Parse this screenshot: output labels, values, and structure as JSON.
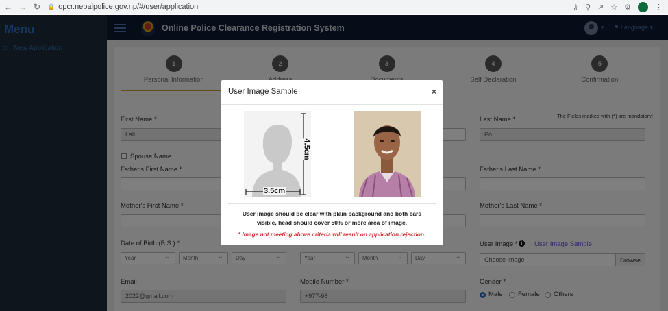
{
  "browser": {
    "url": "opcr.nepalpolice.gov.np/#/user/application",
    "profile_initial": "i"
  },
  "sidebar": {
    "title": "Menu",
    "items": [
      {
        "label": "New Application"
      }
    ]
  },
  "header": {
    "title": "Online Police Clearance Registration System",
    "language_label": "Language"
  },
  "steps": [
    {
      "num": "1",
      "label": "Personal Information"
    },
    {
      "num": "2",
      "label": "Address"
    },
    {
      "num": "3",
      "label": "Documents"
    },
    {
      "num": "4",
      "label": "Self Declaration"
    },
    {
      "num": "5",
      "label": "Confirmation"
    }
  ],
  "form": {
    "mandatory_note": "The Fields marked with (*) are mandatory!",
    "first_name_label": "First Name *",
    "first_name_value": "Lali",
    "last_name_label": "Last Name *",
    "last_name_value": "Po",
    "spouse_label": "Spouse Name",
    "father_first_label": "Father's First Name *",
    "father_last_label": "Father's Last Name *",
    "mother_first_label": "Mother's First Name *",
    "mother_last_label": "Mother's Last Name *",
    "dob_label": "Date of Birth (B.S.) *",
    "year_label": "Year",
    "month_label": "Month",
    "day_label": "Day",
    "user_image_label": "User Image *",
    "user_image_sample_link": "User Image Sample",
    "choose_image": "Choose Image",
    "browse": "Browse",
    "email_label": "Email",
    "email_value": "2022@gmail.com",
    "mobile_label": "Mobile Number *",
    "mobile_value": "+977-98",
    "gender_label": "Gender *",
    "gender_options": [
      "Male",
      "Female",
      "Others"
    ]
  },
  "modal": {
    "title": "User Image Sample",
    "close": "×",
    "height_label": "4.5cm",
    "width_label": "3.5cm",
    "description": "User image should be clear with plain background and both ears visible, head should cover 50% or more area of image.",
    "warning": "* Image not meeting above criteria will result on application rejection."
  }
}
